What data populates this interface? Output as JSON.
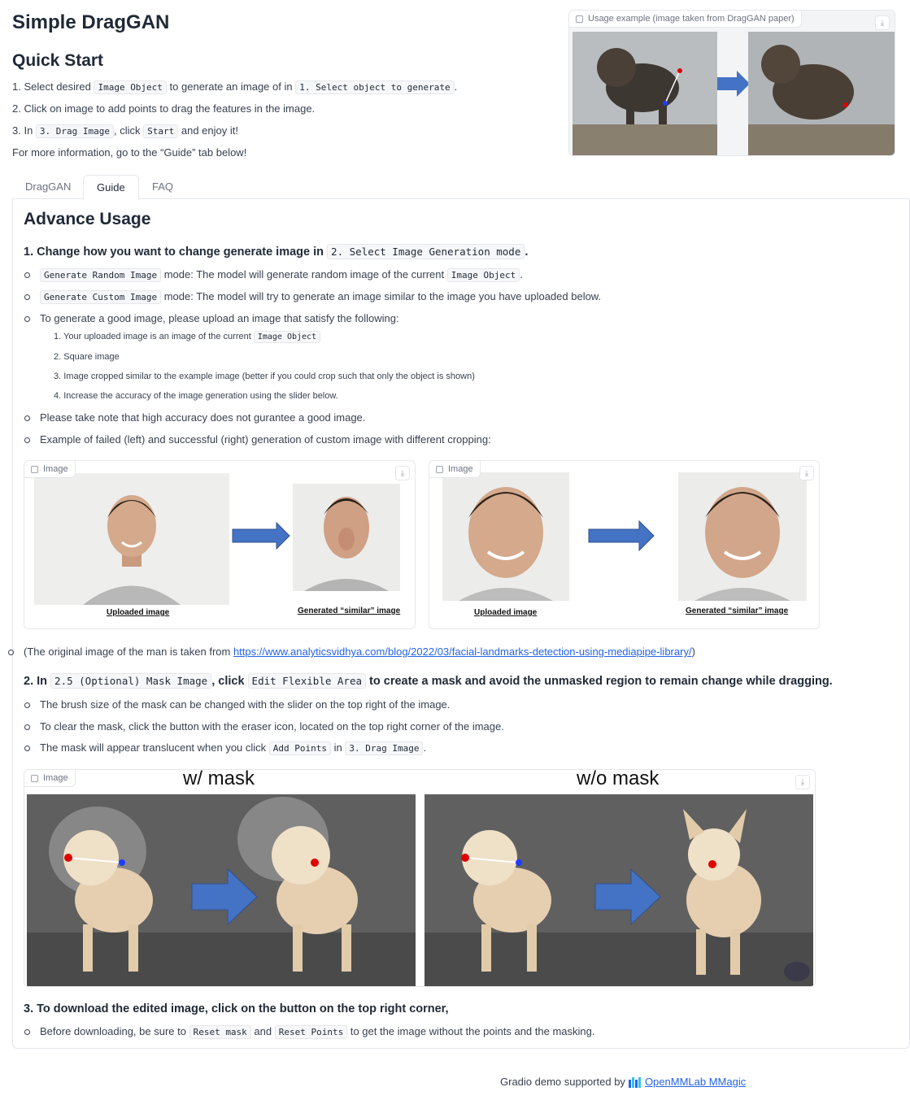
{
  "app": {
    "title": "Simple DragGAN"
  },
  "quick_start": {
    "heading": "Quick Start",
    "line1": {
      "a": "1. Select desired ",
      "code1": "Image Object",
      "b": " to generate an image of in ",
      "code2": "1. Select object to generate",
      "c": "."
    },
    "line2": "2. Click on image to add points to drag the features in the image.",
    "line3": {
      "a": "3. In ",
      "code1": "3. Drag Image",
      "b": ", click ",
      "code2": "Start",
      "c": " and enjoy it!"
    },
    "line4": "For more information, go to the “Guide” tab below!"
  },
  "usage_image": {
    "label": "Usage example (image taken from DragGAN paper)"
  },
  "tabs": [
    {
      "label": "DragGAN"
    },
    {
      "label": "Guide"
    },
    {
      "label": "FAQ"
    }
  ],
  "guide": {
    "heading": "Advance Usage",
    "sec1": {
      "a": "1. Change how you want to change generate image in ",
      "code": "2. Select Image Generation mode",
      "b": "."
    },
    "b1": {
      "code": "Generate Random Image",
      "a": " mode: The model will generate random image of the current ",
      "code2": "Image Object",
      "b": "."
    },
    "b2": {
      "code": "Generate Custom Image",
      "a": " mode: The model will try to generate an image similar to the image you have uploaded below."
    },
    "b3": "To generate a good image, please upload an image that satisfy the following:",
    "sub1": {
      "a": "1. Your uploaded image is an image of the current ",
      "code": "Image Object"
    },
    "sub2": "2. Square image",
    "sub3": "3. Image cropped similar to the example image (better if you could crop such that only the object is shown)",
    "sub4": "4. Increase the accuracy of the image generation using the slider below.",
    "b4": "Please take note that high accuracy does not gurantee a good image.",
    "b5": "Example of failed (left) and successful (right) generation of custom image with different cropping:",
    "img_label": "Image",
    "cap_uploaded": "Uploaded image",
    "cap_generated": "Generated “similar” image",
    "source_a": "(The original image of the man is taken from ",
    "source_link": "https://www.analyticsvidhya.com/blog/2022/03/facial-landmarks-detection-using-mediapipe-library/",
    "source_b": ")",
    "sec2": {
      "a": "2. In ",
      "code1": "2.5 (Optional) Mask Image",
      "b": ", click ",
      "code2": "Edit Flexible Area",
      "c": " to create a mask and avoid the unmasked region to remain change while dragging."
    },
    "b6": "The brush size of the mask can be changed with the slider on the top right of the image.",
    "b7": "To clear the mask, click the button with the eraser icon, located on the top right corner of the image.",
    "b8": {
      "a": "The mask will appear translucent when you click ",
      "code1": "Add Points",
      "b": " in ",
      "code2": "3. Drag Image",
      "c": "."
    },
    "mask_with": "w/ mask",
    "mask_without": "w/o mask",
    "sec3": "3. To download the edited image, click on the button on the top right corner,",
    "b9": {
      "a": "Before downloading, be sure to ",
      "code1": "Reset mask",
      "b": " and ",
      "code2": "Reset Points",
      "c": " to get the image without the points and the masking."
    }
  },
  "footer": {
    "text": "Gradio demo supported by ",
    "link": "OpenMMLab MMagic"
  },
  "colors": {
    "accent_link": "#2563eb",
    "arrow_blue": "#4472c4",
    "point_red": "#e00000",
    "point_blue": "#1f3cff"
  }
}
